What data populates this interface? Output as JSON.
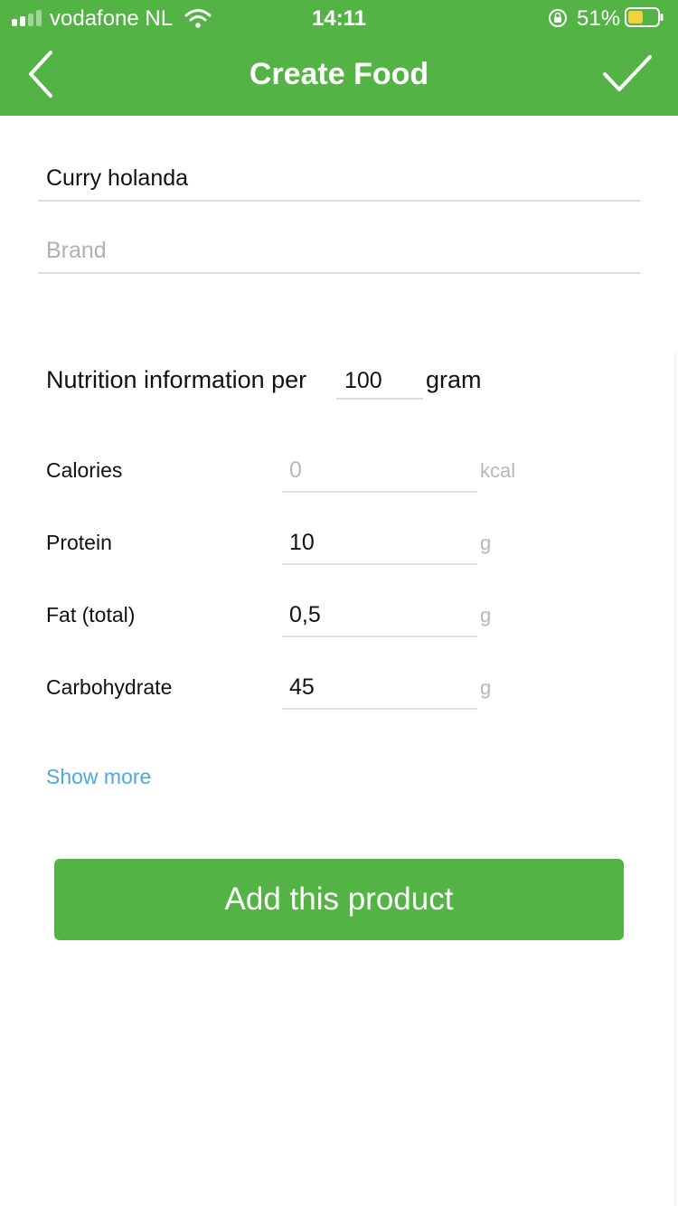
{
  "status_bar": {
    "carrier": "vodafone NL",
    "time": "14:11",
    "battery_percent": "51%",
    "signal_bars": 2,
    "signal_bars_total": 4,
    "battery_level": 0.51,
    "icons": [
      "signal-icon",
      "wifi-icon",
      "rotation-lock-icon",
      "battery-icon"
    ]
  },
  "nav": {
    "title": "Create Food",
    "back_icon": "chevron-left-icon",
    "confirm_icon": "checkmark-icon"
  },
  "form": {
    "name_value": "Curry holanda",
    "brand_placeholder": "Brand",
    "per_label": "Nutrition information per",
    "per_value": "100",
    "per_unit": "gram"
  },
  "nutrients": [
    {
      "label": "Calories",
      "value": "",
      "placeholder": "0",
      "unit": "kcal"
    },
    {
      "label": "Protein",
      "value": "10",
      "placeholder": "",
      "unit": "g"
    },
    {
      "label": "Fat (total)",
      "value": "0,5",
      "placeholder": "",
      "unit": "g"
    },
    {
      "label": "Carbohydrate",
      "value": "45",
      "placeholder": "",
      "unit": "g"
    }
  ],
  "show_more_label": "Show more",
  "add_button_label": "Add this product",
  "colors": {
    "primary_green": "#54b345",
    "link_blue": "#4aa9de",
    "underline_gray": "#dcdcdc",
    "placeholder_gray": "#b0b0b0",
    "battery_yellow": "#f5d23c"
  }
}
